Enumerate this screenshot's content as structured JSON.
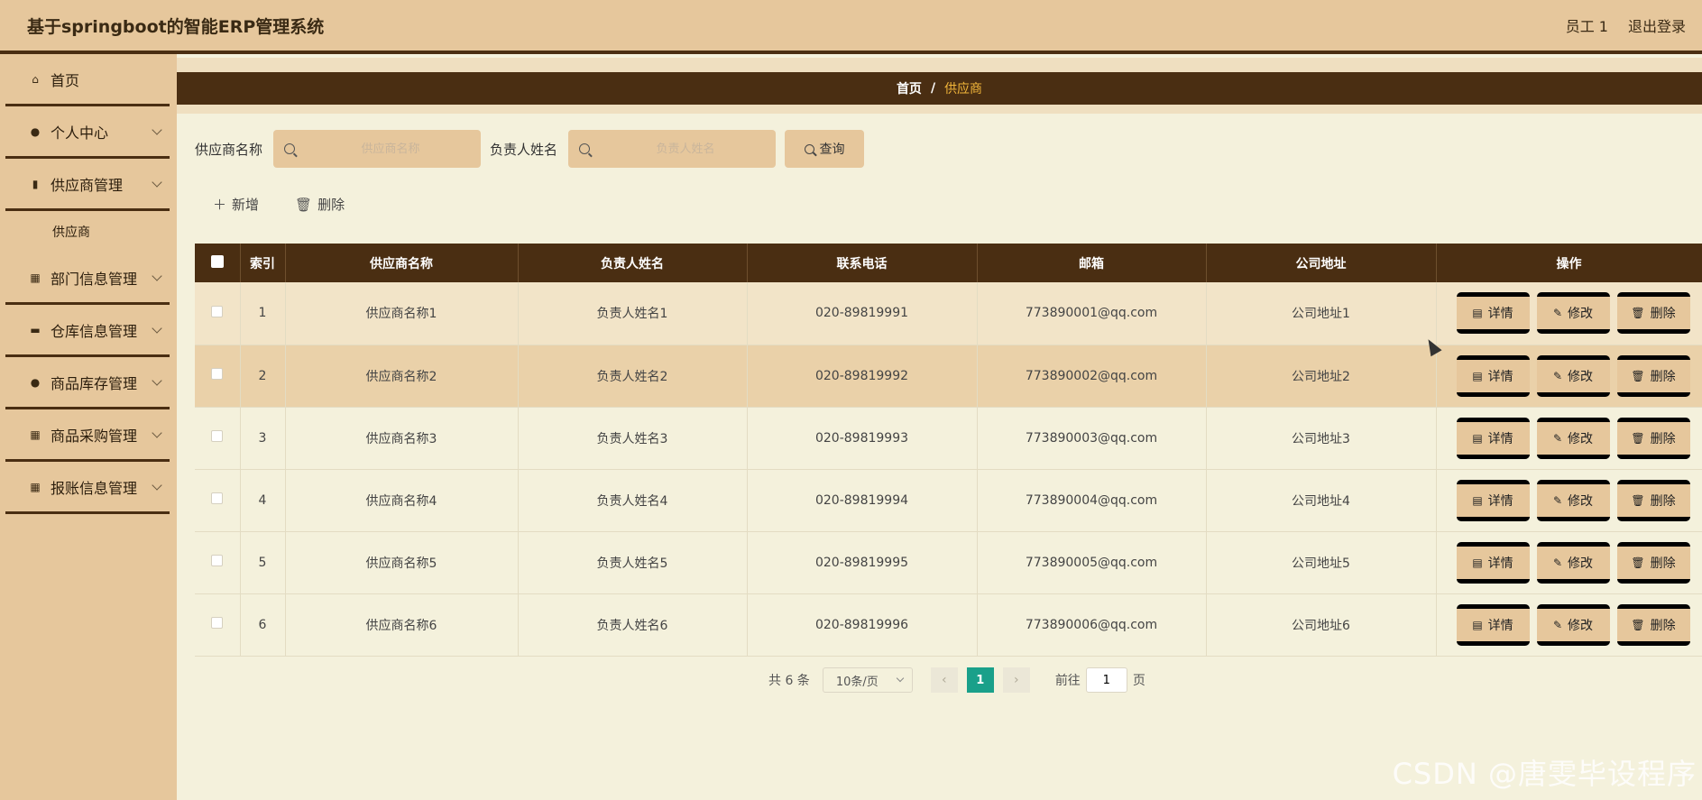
{
  "header": {
    "title": "基于springboot的智能ERP管理系统",
    "user": "员工 1",
    "logout": "退出登录"
  },
  "sidebar": {
    "items": [
      {
        "label": "首页",
        "icon": "home-icon",
        "glyph": "⌂"
      },
      {
        "label": "个人中心",
        "icon": "user-icon",
        "glyph": "●"
      },
      {
        "label": "供应商管理",
        "icon": "clipboard-icon",
        "glyph": "▮"
      },
      {
        "label": "部门信息管理",
        "icon": "grid-icon",
        "glyph": "▦"
      },
      {
        "label": "仓库信息管理",
        "icon": "box-icon",
        "glyph": "▬"
      },
      {
        "label": "商品库存管理",
        "icon": "user-icon",
        "glyph": "●"
      },
      {
        "label": "商品采购管理",
        "icon": "grid-icon",
        "glyph": "▦"
      },
      {
        "label": "报账信息管理",
        "icon": "grid-icon",
        "glyph": "▦"
      }
    ],
    "submenu": "供应商"
  },
  "breadcrumb": {
    "home": "首页",
    "sep": "/",
    "current": "供应商"
  },
  "search": {
    "supplier_label": "供应商名称",
    "supplier_placeholder": "供应商名称",
    "contact_label": "负责人姓名",
    "contact_placeholder": "负责人姓名",
    "query": "查询"
  },
  "actions": {
    "add": "新增",
    "delete": "删除"
  },
  "table": {
    "headers": [
      "索引",
      "供应商名称",
      "负责人姓名",
      "联系电话",
      "邮箱",
      "公司地址",
      "操作"
    ],
    "rows": [
      [
        "1",
        "供应商名称1",
        "负责人姓名1",
        "020-89819991",
        "773890001@qq.com",
        "公司地址1"
      ],
      [
        "2",
        "供应商名称2",
        "负责人姓名2",
        "020-89819992",
        "773890002@qq.com",
        "公司地址2"
      ],
      [
        "3",
        "供应商名称3",
        "负责人姓名3",
        "020-89819993",
        "773890003@qq.com",
        "公司地址3"
      ],
      [
        "4",
        "供应商名称4",
        "负责人姓名4",
        "020-89819994",
        "773890004@qq.com",
        "公司地址4"
      ],
      [
        "5",
        "供应商名称5",
        "负责人姓名5",
        "020-89819995",
        "773890005@qq.com",
        "公司地址5"
      ],
      [
        "6",
        "供应商名称6",
        "负责人姓名6",
        "020-89819996",
        "773890006@qq.com",
        "公司地址6"
      ]
    ],
    "row_actions": {
      "detail": "详情",
      "edit": "修改",
      "delete": "删除"
    }
  },
  "pagination": {
    "total": "共 6 条",
    "page_size": "10条/页",
    "current_page": "1",
    "goto_label": "前往",
    "goto_value": "1",
    "goto_suffix": "页"
  },
  "watermark": "CSDN @唐雯毕设程序",
  "colors": {
    "header_bg": "#e6c79c",
    "dark_brown": "#4a2e12",
    "content_bg": "#f4f1dc",
    "active_page": "#1aa08a",
    "breadcrumb_current": "#f2b63a"
  }
}
